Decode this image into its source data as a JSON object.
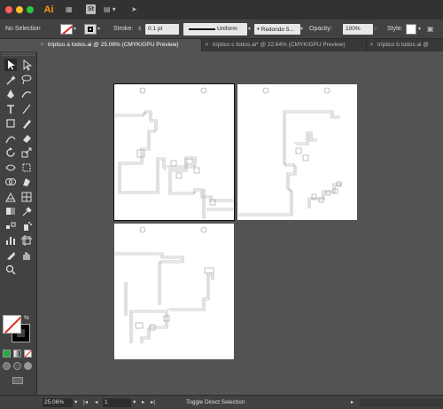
{
  "titlebar": {
    "app_icon": "Ai",
    "bridge_icon": "St"
  },
  "control": {
    "selection_label": "No Selection",
    "stroke_label": "Stroke:",
    "stroke_value": "0.1 pt",
    "profile_label": "Uniform",
    "brush_value": "Redondo 5...",
    "opacity_label": "Opacity:",
    "opacity_value": "100%",
    "style_label": "Style:"
  },
  "tabs": [
    {
      "label": "tríptico a todos.ai @ 25.06% (CMYK/GPU Preview)",
      "active": true
    },
    {
      "label": "tríptico c todos.ai* @ 22.64% (CMYK/GPU Preview)",
      "active": false
    },
    {
      "label": "tríptico b todos.ai @",
      "active": false
    }
  ],
  "status": {
    "zoom": "25.06%",
    "artboard": "1",
    "tool_hint": "Toggle Direct Selection"
  },
  "colors": {
    "fill": "#ffffff",
    "stroke": "#000000",
    "none_slash": "#e0261b",
    "app_accent": "#ff9a00"
  }
}
